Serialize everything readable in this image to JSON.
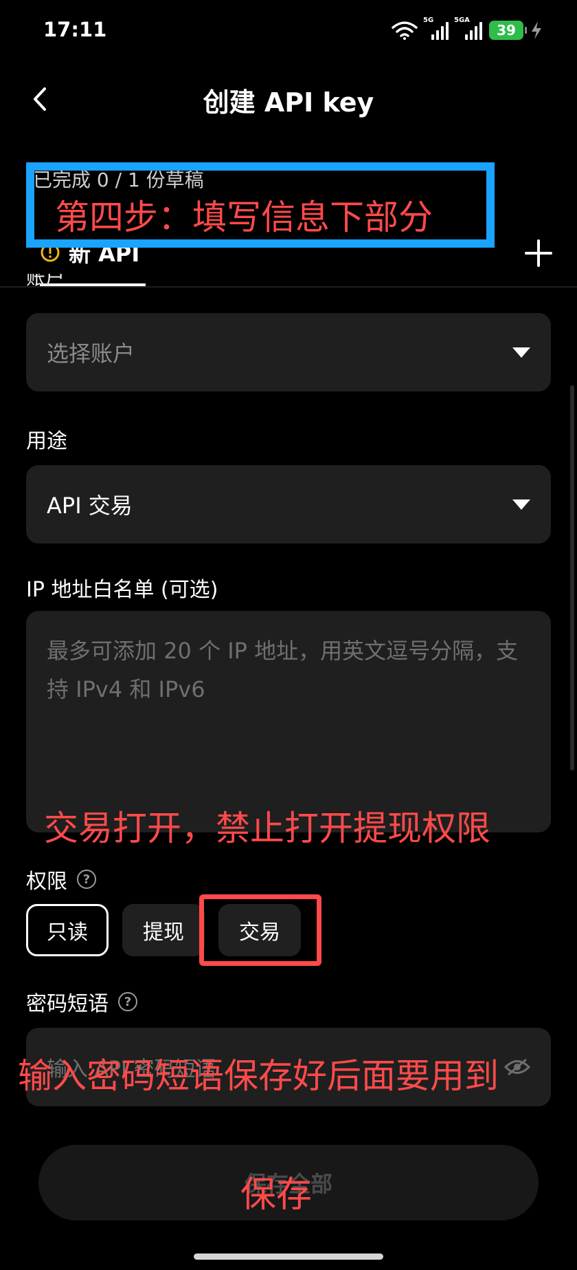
{
  "status_bar": {
    "time": "17:11",
    "signal1_label": "5G",
    "signal2_label": "5GA",
    "battery": "39"
  },
  "header": {
    "title": "创建 API key"
  },
  "draft": {
    "progress_text": "已完成 0 / 1 份草稿",
    "tab_label": "新 API"
  },
  "form": {
    "account": {
      "label": "账户",
      "placeholder": "选择账户"
    },
    "purpose": {
      "label": "用途",
      "value": "API 交易"
    },
    "ip_whitelist": {
      "label": "IP 地址白名单 (可选)",
      "placeholder": "最多可添加 20 个 IP 地址，用英文逗号分隔，支持 IPv4 和 IPv6"
    },
    "permissions": {
      "label": "权限",
      "options": [
        "只读",
        "提现",
        "交易"
      ]
    },
    "passphrase": {
      "label": "密码短语",
      "placeholder": "输入 API 密码短语"
    },
    "save_label": "保存全部"
  },
  "annotations": {
    "step": "第四步：填写信息下部分",
    "permission_note": "交易打开，禁止打开提现权限",
    "passphrase_note": "输入密码短语保存好后面要用到",
    "save_note": "保存"
  },
  "colors": {
    "annotation_red": "#ff4a4a",
    "annotation_blue": "#1aa3ff",
    "battery_green": "#2ebd4b"
  }
}
